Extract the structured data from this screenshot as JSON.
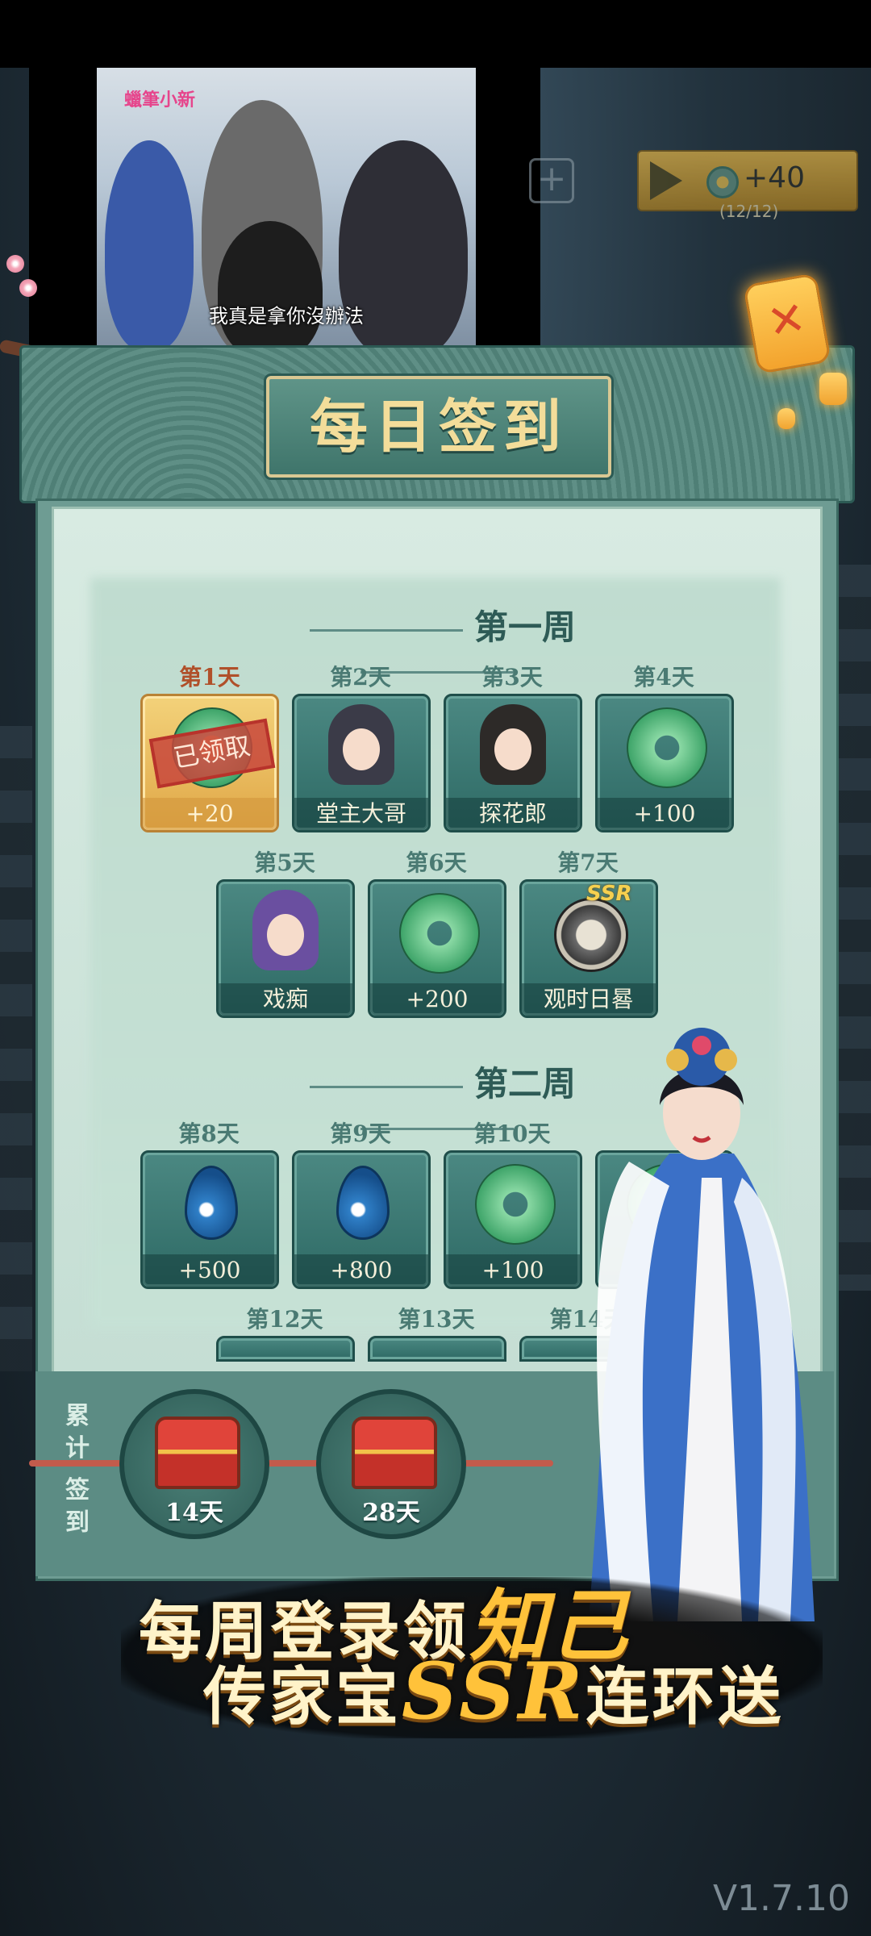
{
  "video": {
    "logo_text": "蠟筆小新",
    "subtitle": "我真是拿你沒辦法"
  },
  "top_reward": {
    "amount": "+40",
    "count": "(12/12)",
    "plus_icon": "plus-icon"
  },
  "header": {
    "title": "每日签到",
    "close_icon": "close-icon"
  },
  "week1": {
    "title": "第一周",
    "days": [
      {
        "label": "第1天",
        "caption": "+20",
        "reward": "jade-coin",
        "claimed": true,
        "stamp": "已领取"
      },
      {
        "label": "第2天",
        "caption": "堂主大哥",
        "reward": "character-portrait"
      },
      {
        "label": "第3天",
        "caption": "探花郎",
        "reward": "character-portrait"
      },
      {
        "label": "第4天",
        "caption": "+100",
        "reward": "jade-coin"
      },
      {
        "label": "第5天",
        "caption": "戏痴",
        "reward": "character-portrait"
      },
      {
        "label": "第6天",
        "caption": "+200",
        "reward": "jade-coin"
      },
      {
        "label": "第7天",
        "caption": "观时日晷",
        "reward": "sundial",
        "tag": "SSR"
      }
    ]
  },
  "week2": {
    "title": "第二周",
    "days": [
      {
        "label": "第8天",
        "caption": "+500",
        "reward": "water-drop"
      },
      {
        "label": "第9天",
        "caption": "+800",
        "reward": "water-drop"
      },
      {
        "label": "第10天",
        "caption": "+100",
        "reward": "jade-coin"
      }
    ],
    "next_labels": [
      "第12天",
      "第13天",
      "第14天"
    ]
  },
  "cumulative": {
    "label_top": [
      "累",
      "计"
    ],
    "label_bottom": [
      "签",
      "到"
    ],
    "chests": [
      {
        "label": "14天"
      },
      {
        "label": "28天"
      }
    ]
  },
  "promo": {
    "line1_pre": "每周登录领",
    "line1_hl": "知己",
    "line2_pre": "传家宝",
    "line2_hl": "SSR",
    "line2_post": "连环送"
  },
  "version": "V1.7.10",
  "colors": {
    "panel_teal": "#4f7f76",
    "gold_text": "#f3dd9a",
    "claimed_gold": "#e0a747",
    "stamp_red": "#b8332b"
  }
}
